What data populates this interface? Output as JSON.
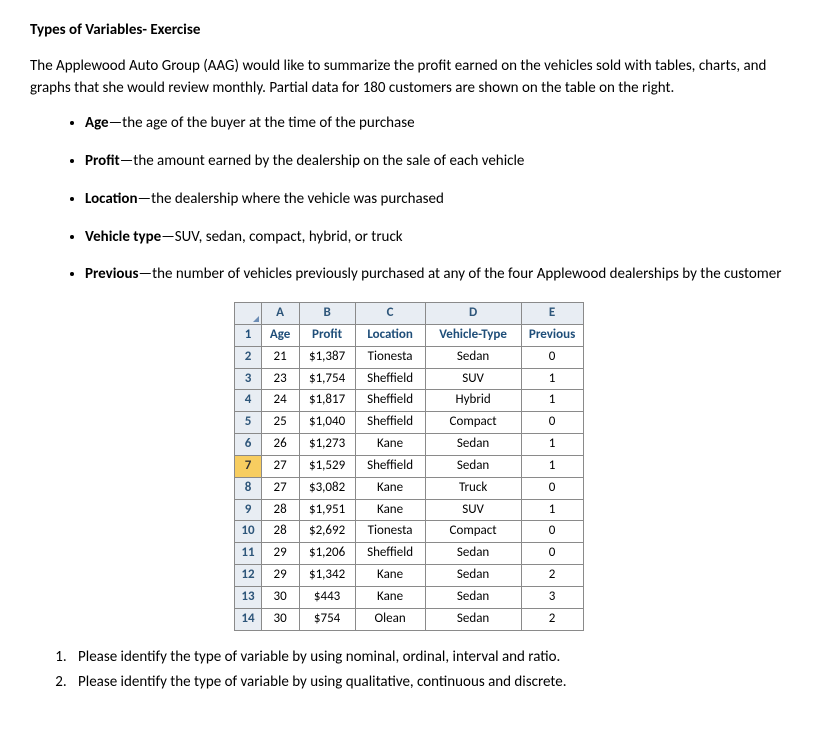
{
  "title": "Types of Variables- Exercise",
  "intro": "The Applewood Auto Group (AAG) would like to summarize the profit earned on the vehicles sold with tables, charts, and graphs that she would review monthly. Partial data for 180 customers are shown on the table on the right.",
  "definitions": [
    {
      "term": "Age",
      "desc": "—the age of the buyer at the time of the purchase"
    },
    {
      "term": "Profit",
      "desc": "—the amount earned by the dealership on the sale of each vehicle"
    },
    {
      "term": "Location",
      "desc": "—the dealership where the vehicle was purchased"
    },
    {
      "term": "Vehicle type",
      "desc": "—SUV, sedan, compact, hybrid, or truck"
    },
    {
      "term": "Previous",
      "desc": "—the number of vehicles previously purchased at any of the four Applewood dealerships by the customer"
    }
  ],
  "spreadsheet": {
    "col_letters": [
      "A",
      "B",
      "C",
      "D",
      "E"
    ],
    "header_row_num": "1",
    "headers": [
      "Age",
      "Profit",
      "Location",
      "Vehicle-Type",
      "Previous"
    ],
    "rows": [
      {
        "num": "2",
        "age": "21",
        "profit": "$1,387",
        "location": "Tionesta",
        "vehicle": "Sedan",
        "previous": "0"
      },
      {
        "num": "3",
        "age": "23",
        "profit": "$1,754",
        "location": "Sheffield",
        "vehicle": "SUV",
        "previous": "1"
      },
      {
        "num": "4",
        "age": "24",
        "profit": "$1,817",
        "location": "Sheffield",
        "vehicle": "Hybrid",
        "previous": "1"
      },
      {
        "num": "5",
        "age": "25",
        "profit": "$1,040",
        "location": "Sheffield",
        "vehicle": "Compact",
        "previous": "0"
      },
      {
        "num": "6",
        "age": "26",
        "profit": "$1,273",
        "location": "Kane",
        "vehicle": "Sedan",
        "previous": "1"
      },
      {
        "num": "7",
        "age": "27",
        "profit": "$1,529",
        "location": "Sheffield",
        "vehicle": "Sedan",
        "previous": "1"
      },
      {
        "num": "8",
        "age": "27",
        "profit": "$3,082",
        "location": "Kane",
        "vehicle": "Truck",
        "previous": "0"
      },
      {
        "num": "9",
        "age": "28",
        "profit": "$1,951",
        "location": "Kane",
        "vehicle": "SUV",
        "previous": "1"
      },
      {
        "num": "10",
        "age": "28",
        "profit": "$2,692",
        "location": "Tionesta",
        "vehicle": "Compact",
        "previous": "0"
      },
      {
        "num": "11",
        "age": "29",
        "profit": "$1,206",
        "location": "Sheffield",
        "vehicle": "Sedan",
        "previous": "0"
      },
      {
        "num": "12",
        "age": "29",
        "profit": "$1,342",
        "location": "Kane",
        "vehicle": "Sedan",
        "previous": "2"
      },
      {
        "num": "13",
        "age": "30",
        "profit": "$443",
        "location": "Kane",
        "vehicle": "Sedan",
        "previous": "3"
      },
      {
        "num": "14",
        "age": "30",
        "profit": "$754",
        "location": "Olean",
        "vehicle": "Sedan",
        "previous": "2"
      }
    ],
    "selected_row_num": "7"
  },
  "questions": [
    "Please identify the type of variable by using nominal, ordinal, interval and ratio.",
    "Please identify the type of variable by using qualitative, continuous and discrete."
  ],
  "chart_data": {
    "type": "table",
    "title": "Applewood Auto Group partial customer data",
    "columns": [
      "Age",
      "Profit",
      "Location",
      "Vehicle-Type",
      "Previous"
    ],
    "rows": [
      [
        21,
        1387,
        "Tionesta",
        "Sedan",
        0
      ],
      [
        23,
        1754,
        "Sheffield",
        "SUV",
        1
      ],
      [
        24,
        1817,
        "Sheffield",
        "Hybrid",
        1
      ],
      [
        25,
        1040,
        "Sheffield",
        "Compact",
        0
      ],
      [
        26,
        1273,
        "Kane",
        "Sedan",
        1
      ],
      [
        27,
        1529,
        "Sheffield",
        "Sedan",
        1
      ],
      [
        27,
        3082,
        "Kane",
        "Truck",
        0
      ],
      [
        28,
        1951,
        "Kane",
        "SUV",
        1
      ],
      [
        28,
        2692,
        "Tionesta",
        "Compact",
        0
      ],
      [
        29,
        1206,
        "Sheffield",
        "Sedan",
        0
      ],
      [
        29,
        1342,
        "Kane",
        "Sedan",
        2
      ],
      [
        30,
        443,
        "Kane",
        "Sedan",
        3
      ],
      [
        30,
        754,
        "Olean",
        "Sedan",
        2
      ]
    ]
  }
}
